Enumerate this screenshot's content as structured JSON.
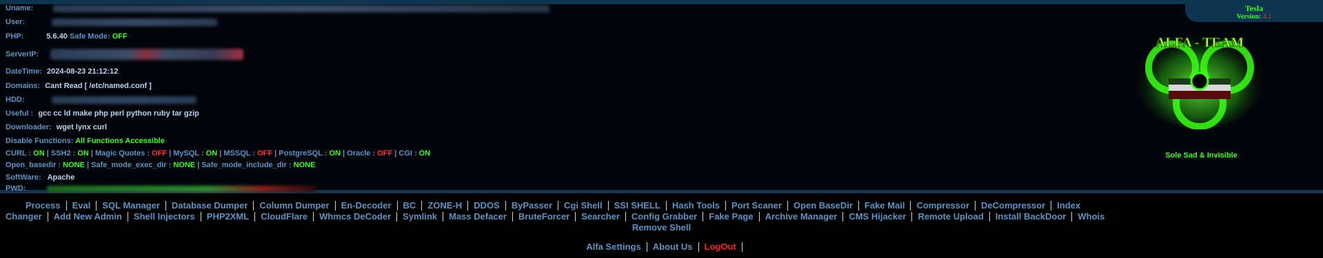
{
  "header_tab": {
    "title": "Tesla",
    "version_label": "Version:",
    "version_number": "4.1"
  },
  "info": {
    "uname_label": "Uname:",
    "user_label": "User:",
    "php_label": "PHP:",
    "php_version": "5.6.40",
    "safe_mode_label": "Safe Mode:",
    "safe_mode_value": "OFF",
    "serverip_label": "ServerIP:",
    "datetime_label": "DateTime:",
    "datetime_value": "2024-08-23 21:12:12",
    "domains_label": "Domains:",
    "domains_value": "Cant Read [ /etc/named.conf ]",
    "hdd_label": "HDD:",
    "useful_label": "Useful :",
    "useful_value": "gcc cc ld make php perl python ruby tar gzip",
    "downloader_label": "Downloader:",
    "downloader_value": "wget lynx curl",
    "disable_label": "Disable Functions:",
    "disable_value": "All Functions Accessible",
    "modules": [
      {
        "name": "CURL :",
        "status": "ON"
      },
      {
        "name": "SSH2 :",
        "status": "ON"
      },
      {
        "name": "Magic Quotes :",
        "status": "OFF"
      },
      {
        "name": "MySQL :",
        "status": "ON"
      },
      {
        "name": "MSSQL :",
        "status": "OFF"
      },
      {
        "name": "PostgreSQL :",
        "status": "ON"
      },
      {
        "name": "Oracle :",
        "status": "OFF"
      },
      {
        "name": "CGI :",
        "status": "ON"
      }
    ],
    "openbasedir": [
      {
        "name": "Open_basedir :",
        "value": "NONE"
      },
      {
        "name": "Safe_mode_exec_dir :",
        "value": "NONE"
      },
      {
        "name": "Safe_mode_include_dir :",
        "value": "NONE"
      }
    ],
    "software_label": "SoftWare:",
    "software_value": "Apache",
    "pwd_label": "PWD:"
  },
  "logo": {
    "alt_text": "ALFA - TEAM",
    "caption": "Sole Sad & Invisible"
  },
  "menu": {
    "line1": [
      "Process",
      "Eval",
      "SQL Manager",
      "Database Dumper",
      "Column Dumper",
      "En-Decoder",
      "BC",
      "ZONE-H",
      "DDOS",
      "ByPasser",
      "Cgi Shell",
      "SSI SHELL",
      "Hash Tools",
      "Port Scaner",
      "Open BaseDir",
      "Fake Mail",
      "Compressor",
      "DeCompressor",
      "Index"
    ],
    "line2": [
      "Changer",
      "Add New Admin",
      "Shell Injectors",
      "PHP2XML",
      "CloudFlare",
      "Whmcs DeCoder",
      "Symlink",
      "Mass Defacer",
      "BruteForcer",
      "Searcher",
      "Config Grabber",
      "Fake Page",
      "Archive Manager",
      "CMS Hijacker",
      "Remote Upload",
      "Install BackDoor",
      "Whois"
    ],
    "line3": [
      "Remove Shell"
    ],
    "bottom": [
      "Alfa Settings",
      "About Us",
      "LogOut"
    ]
  },
  "colors": {
    "on": "#39ff14",
    "off": "#ff3030",
    "accent": "#5b93c2",
    "bar": "#0d3550"
  }
}
